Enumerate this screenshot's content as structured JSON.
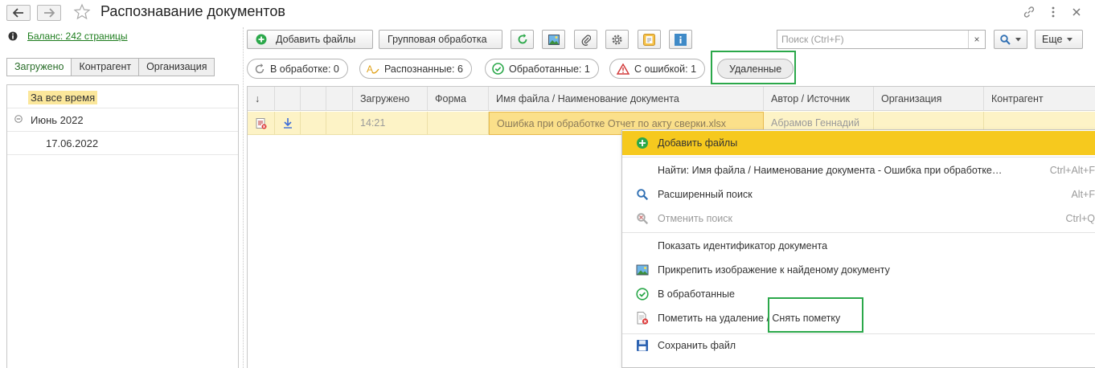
{
  "window": {
    "title": "Распознавание документов",
    "icons": [
      "back-arrow-icon",
      "forward-arrow-icon",
      "star-icon",
      "link-icon",
      "more-vert-icon",
      "close-icon"
    ]
  },
  "left": {
    "balance": "Баланс: 242 страницы",
    "tabs": [
      "Загружено",
      "Контрагент",
      "Организация"
    ],
    "tree": {
      "all_time": "За все время",
      "month": "Июнь 2022",
      "day": "17.06.2022"
    }
  },
  "toolbar": {
    "add_files": "Добавить файлы",
    "group_processing": "Групповая обработка",
    "search_placeholder": "Поиск (Ctrl+F)",
    "search_value": "",
    "clear": "×",
    "more": "Еще"
  },
  "filters": {
    "processing": "В обработке: 0",
    "recognized": "Распознанные: 6",
    "processed": "Обработанные: 1",
    "errors": "С ошибкой: 1",
    "deleted": "Удаленные"
  },
  "grid": {
    "headers": {
      "arrow": "↓",
      "uploaded": "Загружено",
      "form": "Форма",
      "filename": "Имя файла / Наименование документа",
      "author": "Автор / Источник",
      "organization": "Организация",
      "counterparty": "Контрагент"
    },
    "rows": [
      {
        "uploaded": "14:21",
        "form": "",
        "filename": "Ошибка при обработке Отчет по акту сверки.xlsx",
        "author": "Абрамов Геннадий",
        "organization": "",
        "counterparty": ""
      }
    ]
  },
  "context_menu": {
    "add_files": "Добавить файлы",
    "find": "Найти: Имя файла / Наименование документа - Ошибка при обработке…",
    "find_shortcut": "Ctrl+Alt+F",
    "advanced_search": "Расширенный поиск",
    "advanced_shortcut": "Alt+F",
    "cancel_search": "Отменить поиск",
    "cancel_shortcut": "Ctrl+Q",
    "show_id": "Показать идентификатор документа",
    "attach_image": "Прикрепить изображение к найденому документу",
    "to_processed": "В обработанные",
    "mark_delete": "Пометить на удаление / Снять пометку",
    "save_file": "Сохранить файл"
  },
  "colors": {
    "accent_green": "#2ba84a",
    "selection_yellow": "#f6c91e",
    "row_highlight": "#fdf3c6"
  }
}
